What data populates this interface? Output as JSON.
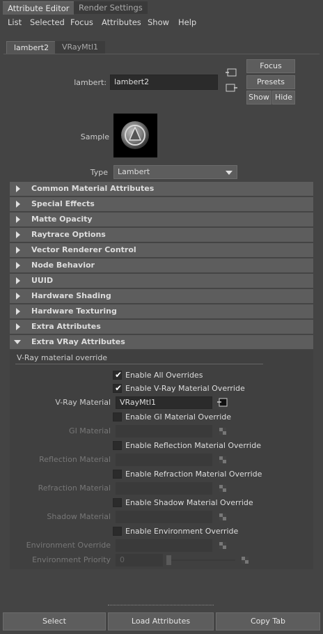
{
  "window_tabs": [
    "Attribute Editor",
    "Render Settings"
  ],
  "menu": [
    "List",
    "Selected",
    "Focus",
    "Attributes",
    "Show",
    "Help"
  ],
  "node_tabs": [
    "lambert2",
    "VRayMtl1"
  ],
  "header": {
    "node_label": "lambert:",
    "node_value": "lambert2",
    "focus_label": "Focus",
    "presets_label": "Presets",
    "show_label": "Show",
    "hide_label": "Hide",
    "sample_label": "Sample",
    "type_label": "Type",
    "type_value": "Lambert"
  },
  "sections": [
    "Common Material Attributes",
    "Special Effects",
    "Matte Opacity",
    "Raytrace Options",
    "Vector Renderer Control",
    "Node Behavior",
    "UUID",
    "Hardware Shading",
    "Hardware Texturing",
    "Extra Attributes",
    "Extra VRay Attributes"
  ],
  "vray": {
    "subsection_title": "V-Ray material override",
    "enable_all": "Enable All Overrides",
    "enable_vray_mtl": "Enable V-Ray Material Override",
    "vray_material_label": "V-Ray Material",
    "vray_material_value": "VRayMtl1",
    "enable_gi": "Enable GI Material Override",
    "gi_label": "GI Material",
    "enable_reflection": "Enable Reflection Material Override",
    "reflection_label": "Reflection Material",
    "enable_refraction": "Enable Refraction Material Override",
    "refraction_label": "Refraction Material",
    "enable_shadow": "Enable Shadow Material Override",
    "shadow_label": "Shadow Material",
    "enable_environment": "Enable Environment Override",
    "environment_override_label": "Environment Override",
    "environment_priority_label": "Environment Priority",
    "environment_priority_value": "0"
  },
  "bottom": {
    "select": "Select",
    "load": "Load Attributes",
    "copy": "Copy Tab"
  },
  "colors": {
    "background": "#444444",
    "section_header": "#5d5d5d",
    "field": "#2b2b2b"
  }
}
